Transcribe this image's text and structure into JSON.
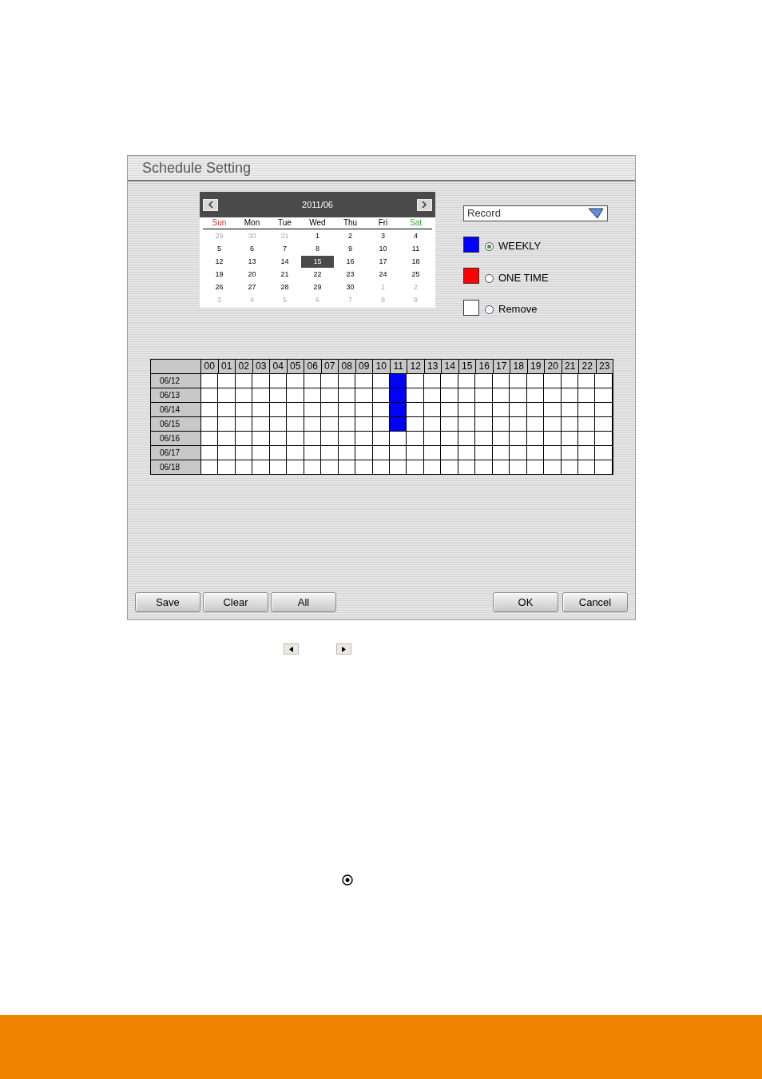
{
  "dialog": {
    "title": "Schedule Setting"
  },
  "calendar": {
    "month": "2011/06",
    "weekdays": [
      {
        "label": "Sun",
        "kind": "sunday"
      },
      {
        "label": "Mon",
        "kind": "weekday"
      },
      {
        "label": "Tue",
        "kind": "weekday"
      },
      {
        "label": "Wed",
        "kind": "weekday"
      },
      {
        "label": "Thu",
        "kind": "weekday"
      },
      {
        "label": "Fri",
        "kind": "weekday"
      },
      {
        "label": "Sat",
        "kind": "saturday"
      }
    ],
    "weeks": [
      [
        {
          "day": "29",
          "outside": true,
          "selected": false
        },
        {
          "day": "30",
          "outside": true,
          "selected": false
        },
        {
          "day": "31",
          "outside": true,
          "selected": false
        },
        {
          "day": "1",
          "outside": false,
          "selected": false
        },
        {
          "day": "2",
          "outside": false,
          "selected": false
        },
        {
          "day": "3",
          "outside": false,
          "selected": false
        },
        {
          "day": "4",
          "outside": false,
          "selected": false
        }
      ],
      [
        {
          "day": "5",
          "outside": false,
          "selected": false
        },
        {
          "day": "6",
          "outside": false,
          "selected": false
        },
        {
          "day": "7",
          "outside": false,
          "selected": false
        },
        {
          "day": "8",
          "outside": false,
          "selected": false
        },
        {
          "day": "9",
          "outside": false,
          "selected": false
        },
        {
          "day": "10",
          "outside": false,
          "selected": false
        },
        {
          "day": "11",
          "outside": false,
          "selected": false
        }
      ],
      [
        {
          "day": "12",
          "outside": false,
          "selected": false
        },
        {
          "day": "13",
          "outside": false,
          "selected": false
        },
        {
          "day": "14",
          "outside": false,
          "selected": false
        },
        {
          "day": "15",
          "outside": false,
          "selected": true
        },
        {
          "day": "16",
          "outside": false,
          "selected": false
        },
        {
          "day": "17",
          "outside": false,
          "selected": false
        },
        {
          "day": "18",
          "outside": false,
          "selected": false
        }
      ],
      [
        {
          "day": "19",
          "outside": false,
          "selected": false
        },
        {
          "day": "20",
          "outside": false,
          "selected": false
        },
        {
          "day": "21",
          "outside": false,
          "selected": false
        },
        {
          "day": "22",
          "outside": false,
          "selected": false
        },
        {
          "day": "23",
          "outside": false,
          "selected": false
        },
        {
          "day": "24",
          "outside": false,
          "selected": false
        },
        {
          "day": "25",
          "outside": false,
          "selected": false
        }
      ],
      [
        {
          "day": "26",
          "outside": false,
          "selected": false
        },
        {
          "day": "27",
          "outside": false,
          "selected": false
        },
        {
          "day": "28",
          "outside": false,
          "selected": false
        },
        {
          "day": "29",
          "outside": false,
          "selected": false
        },
        {
          "day": "30",
          "outside": false,
          "selected": false
        },
        {
          "day": "1",
          "outside": true,
          "selected": false
        },
        {
          "day": "2",
          "outside": true,
          "selected": false
        }
      ],
      [
        {
          "day": "3",
          "outside": true,
          "selected": false
        },
        {
          "day": "4",
          "outside": true,
          "selected": false
        },
        {
          "day": "5",
          "outside": true,
          "selected": false
        },
        {
          "day": "6",
          "outside": true,
          "selected": false
        },
        {
          "day": "7",
          "outside": true,
          "selected": false
        },
        {
          "day": "8",
          "outside": true,
          "selected": false
        },
        {
          "day": "9",
          "outside": true,
          "selected": false
        }
      ]
    ]
  },
  "type_select": {
    "value": "Record"
  },
  "modes": [
    {
      "label": "WEEKLY",
      "color": "#0000ff",
      "selected": true
    },
    {
      "label": "ONE TIME",
      "color": "#ff0000",
      "selected": false
    },
    {
      "label": "Remove",
      "color": "#ffffff",
      "selected": false
    }
  ],
  "schedule": {
    "hours": [
      "00",
      "01",
      "02",
      "03",
      "04",
      "05",
      "06",
      "07",
      "08",
      "09",
      "10",
      "11",
      "12",
      "13",
      "14",
      "15",
      "16",
      "17",
      "18",
      "19",
      "20",
      "21",
      "22",
      "23"
    ],
    "rows": [
      {
        "date": "06/12",
        "cells": [
          false,
          false,
          false,
          false,
          false,
          false,
          false,
          false,
          false,
          false,
          false,
          true,
          false,
          false,
          false,
          false,
          false,
          false,
          false,
          false,
          false,
          false,
          false,
          false
        ]
      },
      {
        "date": "06/13",
        "cells": [
          false,
          false,
          false,
          false,
          false,
          false,
          false,
          false,
          false,
          false,
          false,
          true,
          false,
          false,
          false,
          false,
          false,
          false,
          false,
          false,
          false,
          false,
          false,
          false
        ]
      },
      {
        "date": "06/14",
        "cells": [
          false,
          false,
          false,
          false,
          false,
          false,
          false,
          false,
          false,
          false,
          false,
          true,
          false,
          false,
          false,
          false,
          false,
          false,
          false,
          false,
          false,
          false,
          false,
          false
        ]
      },
      {
        "date": "06/15",
        "cells": [
          false,
          false,
          false,
          false,
          false,
          false,
          false,
          false,
          false,
          false,
          false,
          true,
          false,
          false,
          false,
          false,
          false,
          false,
          false,
          false,
          false,
          false,
          false,
          false
        ]
      },
      {
        "date": "06/16",
        "cells": [
          false,
          false,
          false,
          false,
          false,
          false,
          false,
          false,
          false,
          false,
          false,
          false,
          false,
          false,
          false,
          false,
          false,
          false,
          false,
          false,
          false,
          false,
          false,
          false
        ]
      },
      {
        "date": "06/17",
        "cells": [
          false,
          false,
          false,
          false,
          false,
          false,
          false,
          false,
          false,
          false,
          false,
          false,
          false,
          false,
          false,
          false,
          false,
          false,
          false,
          false,
          false,
          false,
          false,
          false
        ]
      },
      {
        "date": "06/18",
        "cells": [
          false,
          false,
          false,
          false,
          false,
          false,
          false,
          false,
          false,
          false,
          false,
          false,
          false,
          false,
          false,
          false,
          false,
          false,
          false,
          false,
          false,
          false,
          false,
          false
        ]
      }
    ]
  },
  "buttons_left": [
    "Save",
    "Clear",
    "All"
  ],
  "buttons_right": [
    "OK",
    "Cancel"
  ]
}
